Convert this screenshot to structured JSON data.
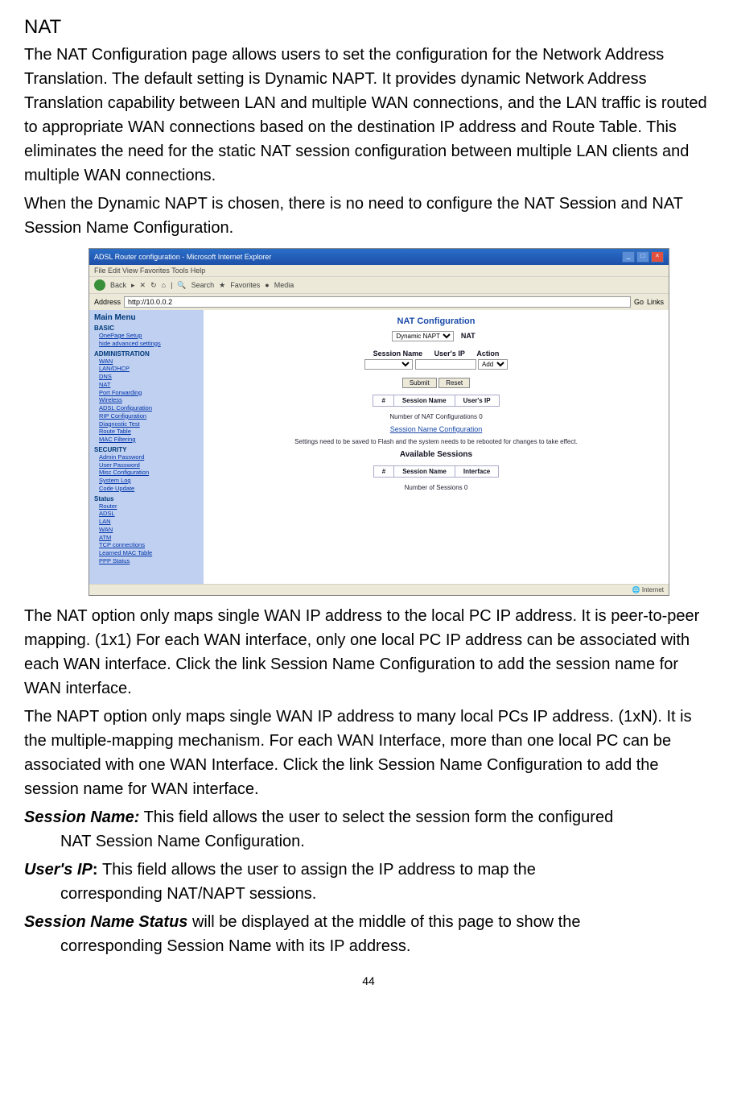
{
  "heading": "NAT",
  "para1": "The NAT Configuration page allows users to set the configuration for the Network Address Translation. The default setting is Dynamic NAPT. It provides dynamic Network Address Translation capability between LAN and multiple WAN connections, and the LAN traffic is routed to appropriate WAN connections based on the destination IP address and Route Table. This eliminates the need for the static NAT session configuration between multiple LAN clients and multiple WAN connections.",
  "para2": "When the Dynamic NAPT is chosen, there is no need to configure the NAT Session and NAT Session Name Configuration.",
  "browser": {
    "title": "ADSL Router configuration - Microsoft Internet Explorer",
    "menu": "File   Edit   View   Favorites   Tools   Help",
    "toolbar": {
      "back": "Back",
      "search": "Search",
      "favorites": "Favorites",
      "media": "Media"
    },
    "address_label": "Address",
    "address": "http://10.0.0.2",
    "go": "Go",
    "links": "Links",
    "sidebar": {
      "title": "Main Menu",
      "basic": "BASIC",
      "items_basic": [
        "OnePage Setup",
        "hide advanced settings"
      ],
      "admin": "ADMINISTRATION",
      "items_admin": [
        "WAN",
        "LAN/DHCP",
        "DNS",
        "NAT",
        "Port Forwarding",
        "Wireless",
        "ADSL Configuration",
        "RIP Configuration",
        "Diagnostic Test",
        "Route Table",
        "MAC Filtering"
      ],
      "security": "SECURITY",
      "items_security": [
        "Admin Password",
        "User Password",
        "Misc Configuration",
        "System Log",
        "Code Update"
      ],
      "status": "Status",
      "items_status": [
        "Router",
        "ADSL",
        "LAN",
        "WAN",
        "ATM",
        "TCP connections",
        "Learned MAC Table",
        "PPP Status"
      ]
    },
    "content": {
      "title": "NAT Configuration",
      "dropdown": "Dynamic NAPT",
      "nat_label": "NAT",
      "session_name": "Session Name",
      "users_ip": "User's IP",
      "action": "Action",
      "action_dropdown": "Add",
      "submit": "Submit",
      "reset": "Reset",
      "table1_hash": "#",
      "table1_col1": "Session Name",
      "table1_col2": "User's IP",
      "count1": "Number of NAT Configurations 0",
      "link": "Session Name Configuration",
      "note": "Settings need to be saved to Flash and the system needs to be rebooted for changes to take effect.",
      "avail": "Available Sessions",
      "table2_hash": "#",
      "table2_col1": "Session Name",
      "table2_col2": "Interface",
      "count2": "Number of Sessions 0"
    },
    "status": "Internet"
  },
  "para3": "The NAT option only maps single WAN IP address to the local PC IP address. It is peer-to-peer mapping. (1x1) For each WAN interface, only one local PC IP address can be associated with each WAN interface. Click the link Session Name Configuration to add the session name for WAN interface.",
  "para4": "The NAPT option only maps single WAN IP address to many local PCs IP address. (1xN). It is the multiple-mapping mechanism. For each WAN Interface, more than one local PC can be associated with one WAN Interface. Click the link Session Name Configuration to add the session name for WAN interface.",
  "def1": {
    "term": "Session Name:",
    "text": " This field allows the user to select the session form the configured",
    "cont": "NAT Session Name Configuration."
  },
  "def2": {
    "term": "User's IP",
    "colon": ": ",
    "text": "This field allows the user to assign the IP address to map the",
    "cont": "corresponding NAT/NAPT sessions."
  },
  "def3": {
    "term": "Session Name Status",
    "text": " will be displayed at the middle of this page to show the",
    "cont": "corresponding Session Name with its IP address."
  },
  "page_num": "44"
}
